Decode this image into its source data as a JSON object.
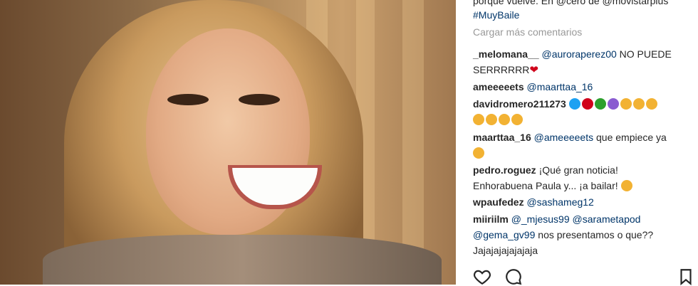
{
  "caption": {
    "line1": "porque vuelve. En @cero de @movistarplus",
    "line2": "#MuyBaile"
  },
  "load_more": "Cargar más comentarios",
  "comments": [
    {
      "user": "_melomana__",
      "mention": "@auroraperez00",
      "text": " NO PUEDE",
      "text2": "SERRRRRR"
    },
    {
      "user": "ameeeeets",
      "mention": "@maarttaa_16",
      "text": ""
    },
    {
      "user": "davidromero211273",
      "mention": "",
      "text": ""
    },
    {
      "user": "maarttaa_16",
      "mention": "@ameeeeets",
      "text": " que empiece ya"
    },
    {
      "user": "pedro.roguez",
      "mention": "",
      "text": "¡Qué gran noticia!",
      "text2": "Enhorabuena Paula y... ¡a bailar!"
    },
    {
      "user": "wpaufedez",
      "mention": "@sashameg12",
      "text": ""
    },
    {
      "user": "miiriilm",
      "mention": "@_mjesus99",
      "mention2": "@sarametapod",
      "mention3": "@gema_gv99",
      "text": " nos presentamos o que??",
      "text2": "Jajajajajajajaja"
    }
  ],
  "icons": {
    "like": "heart-outline-icon",
    "comment": "speech-bubble-icon",
    "save": "bookmark-icon"
  },
  "colors": {
    "mention": "#003569",
    "text": "#262626",
    "muted": "#999999",
    "heart": "#d0021b"
  }
}
